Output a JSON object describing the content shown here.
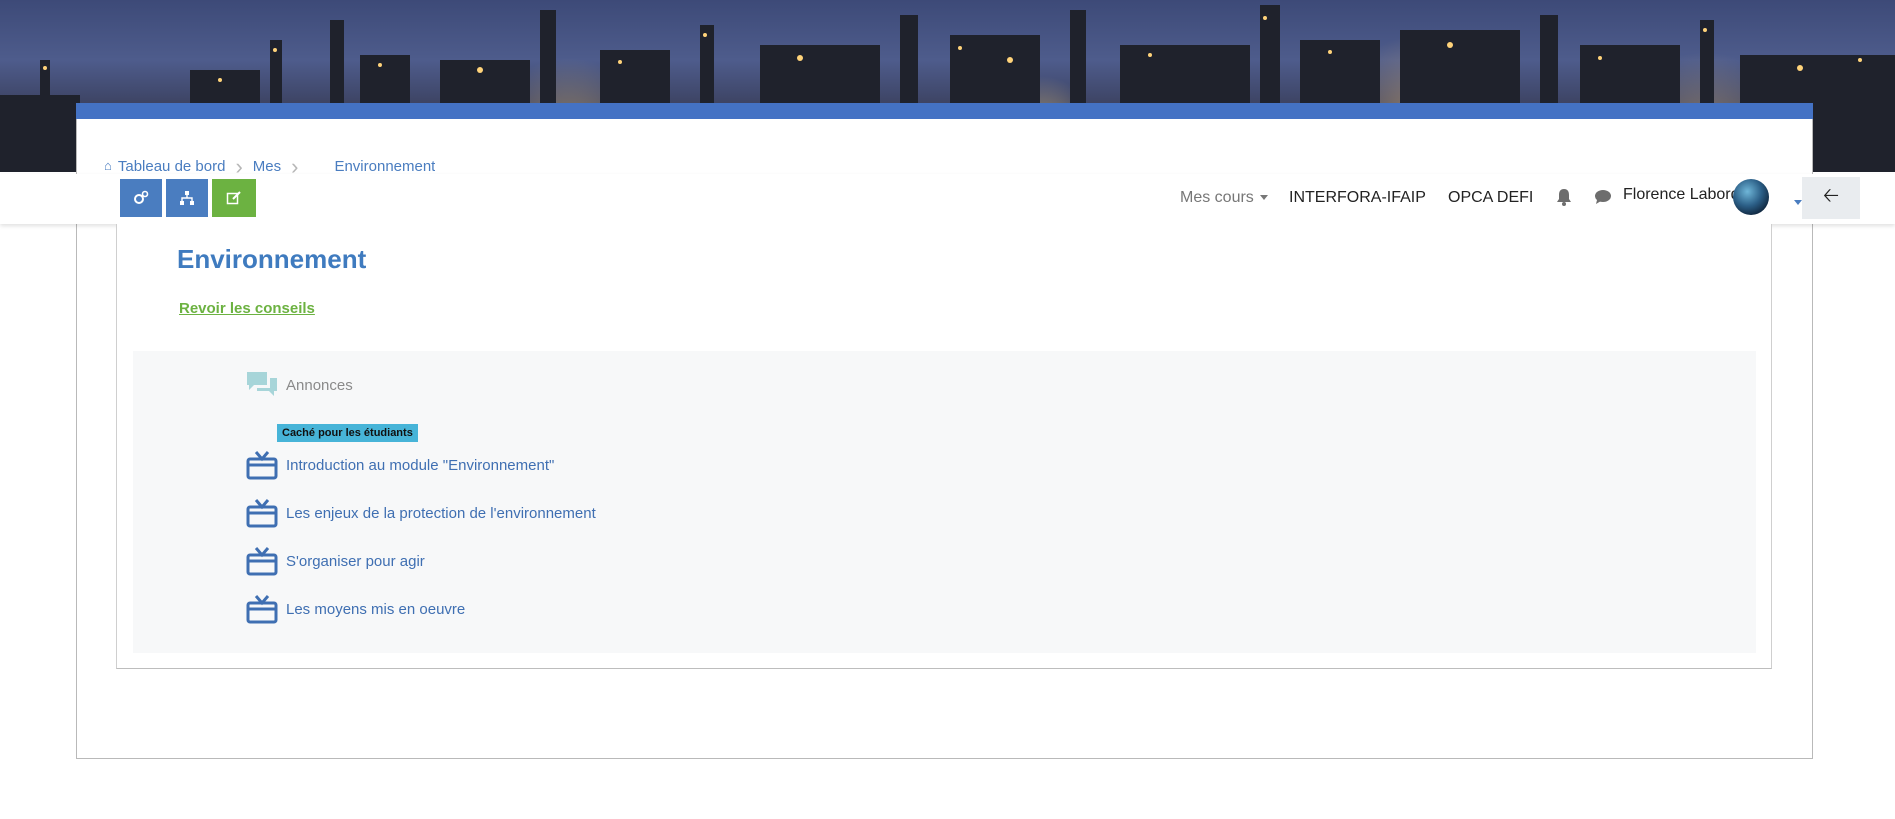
{
  "breadcrumb": {
    "items": [
      "Tableau de bord",
      "Mes",
      "Environnement"
    ]
  },
  "toolbar": {
    "buttons": [
      {
        "icon": "gears-icon",
        "color": "#4a7dc0"
      },
      {
        "icon": "sitemap-icon",
        "color": "#4a7dc0"
      },
      {
        "icon": "edit-icon",
        "color": "#6cb241"
      }
    ]
  },
  "navbar": {
    "my_courses": "Mes cours",
    "link_1": "INTERFORA-IFAIP",
    "link_2": "OPCA DEFI",
    "user_name": "Florence Labord"
  },
  "page": {
    "title": "Environnement",
    "tips_link": "Revoir les conseils"
  },
  "section": {
    "announcements": "Annonces",
    "hidden_badge": "Caché pour les étudiants",
    "activities": [
      "Introduction au module \"Environnement\"",
      "Les enjeux de la protection de l'environnement",
      "S'organiser pour agir",
      "Les moyens mis en oeuvre"
    ]
  },
  "colors": {
    "accent_blue": "#4a7dc0",
    "accent_green": "#6cb241",
    "badge": "#47b4d8",
    "stripe": "#4472c4"
  }
}
